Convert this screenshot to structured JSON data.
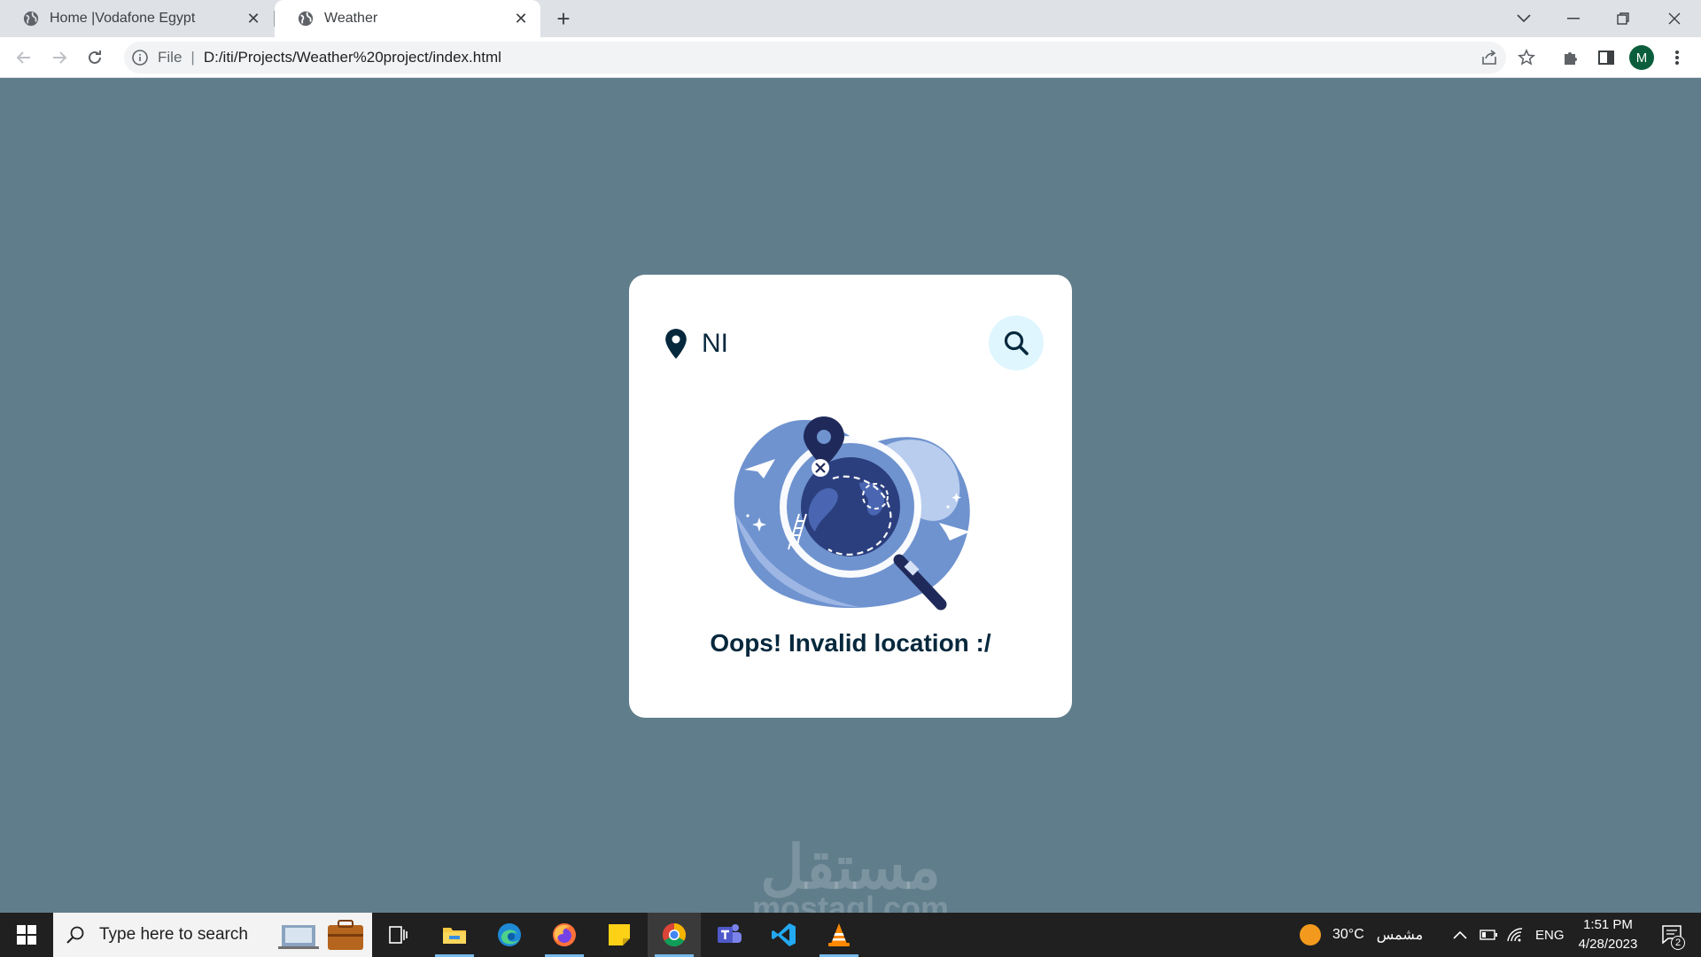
{
  "browser": {
    "tabs": [
      {
        "title": "Home |Vodafone Egypt",
        "active": false
      },
      {
        "title": "Weather",
        "active": true
      }
    ],
    "address": {
      "scheme": "File",
      "url": "D:/iti/Projects/Weather%20project/index.html"
    },
    "profile_initial": "M"
  },
  "app": {
    "search": {
      "value": "NI"
    },
    "error_message": "Oops! Invalid location :/",
    "colors": {
      "background": "#607d8b",
      "card": "#ffffff",
      "text": "#06283d",
      "search_button": "#dff6ff"
    }
  },
  "watermark": {
    "arabic": "مستقل",
    "latin": "mostaql.com"
  },
  "taskbar": {
    "search_placeholder": "Type here to search",
    "weather": {
      "temperature": "30°C",
      "condition": "مشمس"
    },
    "language": "ENG",
    "time": "1:51 PM",
    "date": "4/28/2023",
    "notifications": "2"
  }
}
